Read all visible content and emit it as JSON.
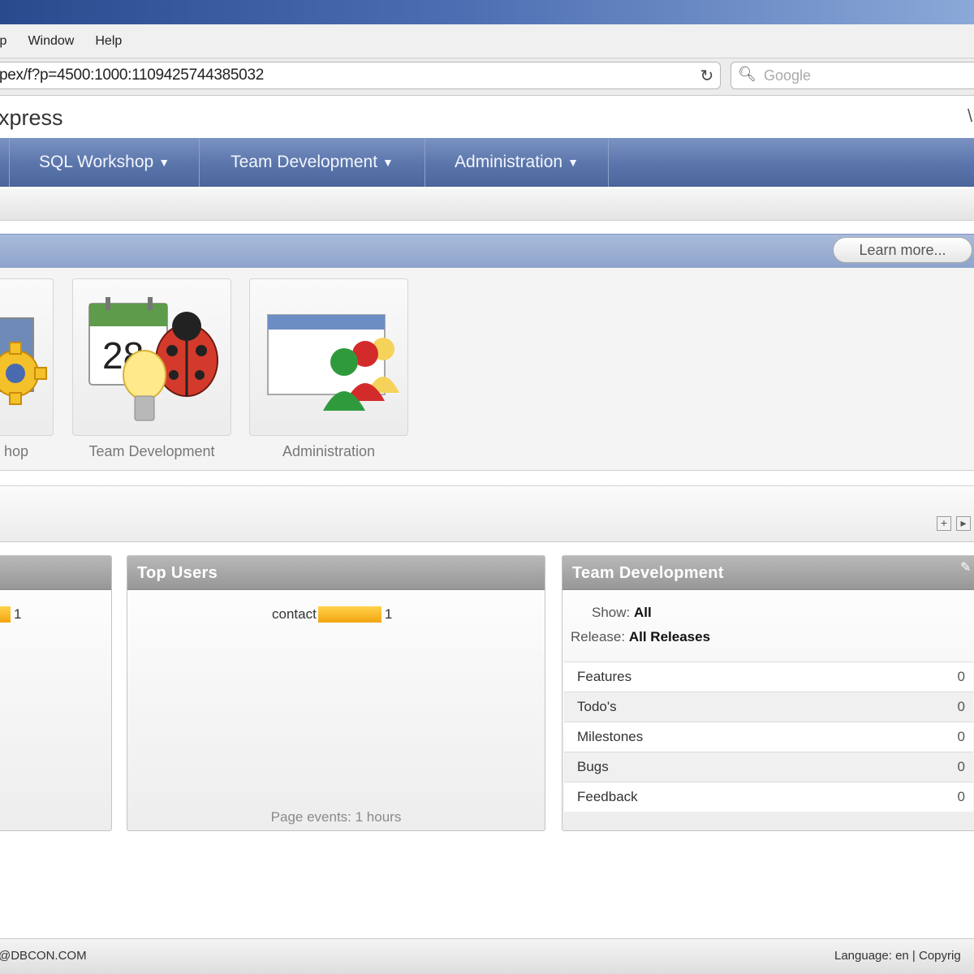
{
  "browser": {
    "menu": [
      "lp",
      "Window",
      "Help"
    ],
    "url": "pex/f?p=4500:1000:1109425744385032",
    "search_placeholder": "Google"
  },
  "app": {
    "title": "xpress",
    "nav": [
      {
        "label": "SQL Workshop"
      },
      {
        "label": "Team Development"
      },
      {
        "label": "Administration"
      }
    ],
    "learn_more": "Learn more..."
  },
  "tiles": [
    {
      "label": "hop",
      "icon": "gear-icon"
    },
    {
      "label": "Team Development",
      "icon": "calendar-ladybug-bulb-icon",
      "calendar_day": "28"
    },
    {
      "label": "Administration",
      "icon": "window-users-icon"
    }
  ],
  "panels": {
    "left": {
      "bar_value": "1"
    },
    "top_users": {
      "title": "Top Users",
      "user": "contact",
      "value": "1",
      "footer": "Page events: 1 hours"
    },
    "team_dev": {
      "title": "Team Development",
      "show_label": "Show:",
      "show_value": "All",
      "release_label": "Release:",
      "release_value": "All Releases",
      "rows": [
        {
          "label": "Features",
          "count": "0"
        },
        {
          "label": "Todo's",
          "count": "0"
        },
        {
          "label": "Milestones",
          "count": "0"
        },
        {
          "label": "Bugs",
          "count": "0"
        },
        {
          "label": "Feedback",
          "count": "0"
        }
      ]
    }
  },
  "footer": {
    "left": "@DBCON.COM",
    "right": "Language: en | Copyrig"
  },
  "colors": {
    "nav": "#5a75ab",
    "bar": "#f3a510",
    "panel_head": "#979797"
  }
}
